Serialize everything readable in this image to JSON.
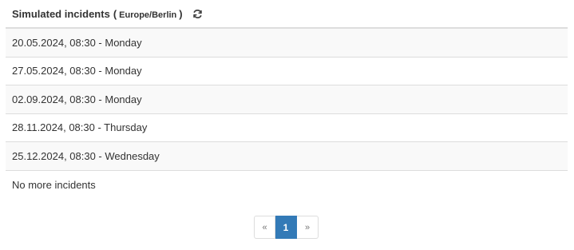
{
  "panel": {
    "title": "Simulated incidents",
    "timezone_open": "(",
    "timezone": "Europe/Berlin",
    "timezone_close": ")",
    "refresh_icon": "refresh-icon"
  },
  "incidents": [
    {
      "label": "20.05.2024, 08:30 - Monday"
    },
    {
      "label": "27.05.2024, 08:30 - Monday"
    },
    {
      "label": "02.09.2024, 08:30 - Monday"
    },
    {
      "label": "28.11.2024, 08:30 - Thursday"
    },
    {
      "label": "25.12.2024, 08:30 - Wednesday"
    }
  ],
  "footer_text": "No more incidents",
  "pagination": {
    "prev": "«",
    "current": "1",
    "next": "»"
  },
  "colors": {
    "accent": "#337ab7",
    "row_striped": "#f9f9f9",
    "border": "#dddddd"
  }
}
